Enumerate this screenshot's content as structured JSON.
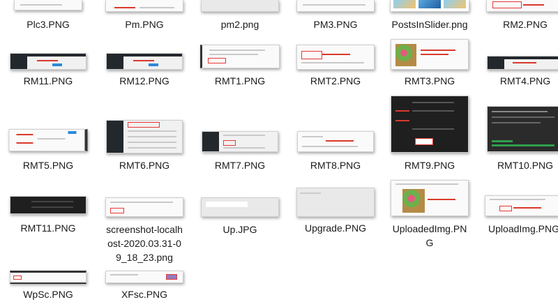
{
  "files": [
    {
      "name": "Plc3.PNG"
    },
    {
      "name": "Pm.PNG"
    },
    {
      "name": "pm2.png"
    },
    {
      "name": "PM3.PNG"
    },
    {
      "name": "PostsInSlider.png"
    },
    {
      "name": "RM2.PNG"
    },
    {
      "name": "RM11.PNG"
    },
    {
      "name": "RM12.PNG"
    },
    {
      "name": "RMT1.PNG"
    },
    {
      "name": "RMT2.PNG"
    },
    {
      "name": "RMT3.PNG"
    },
    {
      "name": "RMT4.PNG"
    },
    {
      "name": "RMT5.PNG"
    },
    {
      "name": "RMT6.PNG"
    },
    {
      "name": "RMT7.PNG"
    },
    {
      "name": "RMT8.PNG"
    },
    {
      "name": "RMT9.PNG"
    },
    {
      "name": "RMT10.PNG"
    },
    {
      "name": "RMT11.PNG"
    },
    {
      "name": "screenshot-localhost-2020.03.31-09_18_23.png",
      "display": "screenshot-localh\nost-2020.03.31-0\n9_18_23.png"
    },
    {
      "name": "Up.JPG"
    },
    {
      "name": "Upgrade.PNG"
    },
    {
      "name": "UploadedImg.PNG",
      "display": "UploadedImg.PN\nG"
    },
    {
      "name": "UploadImg.PNG",
      "display": "UploadImg.PNG"
    },
    {
      "name": "WpSc.PNG"
    },
    {
      "name": "XFsc.PNG"
    }
  ]
}
